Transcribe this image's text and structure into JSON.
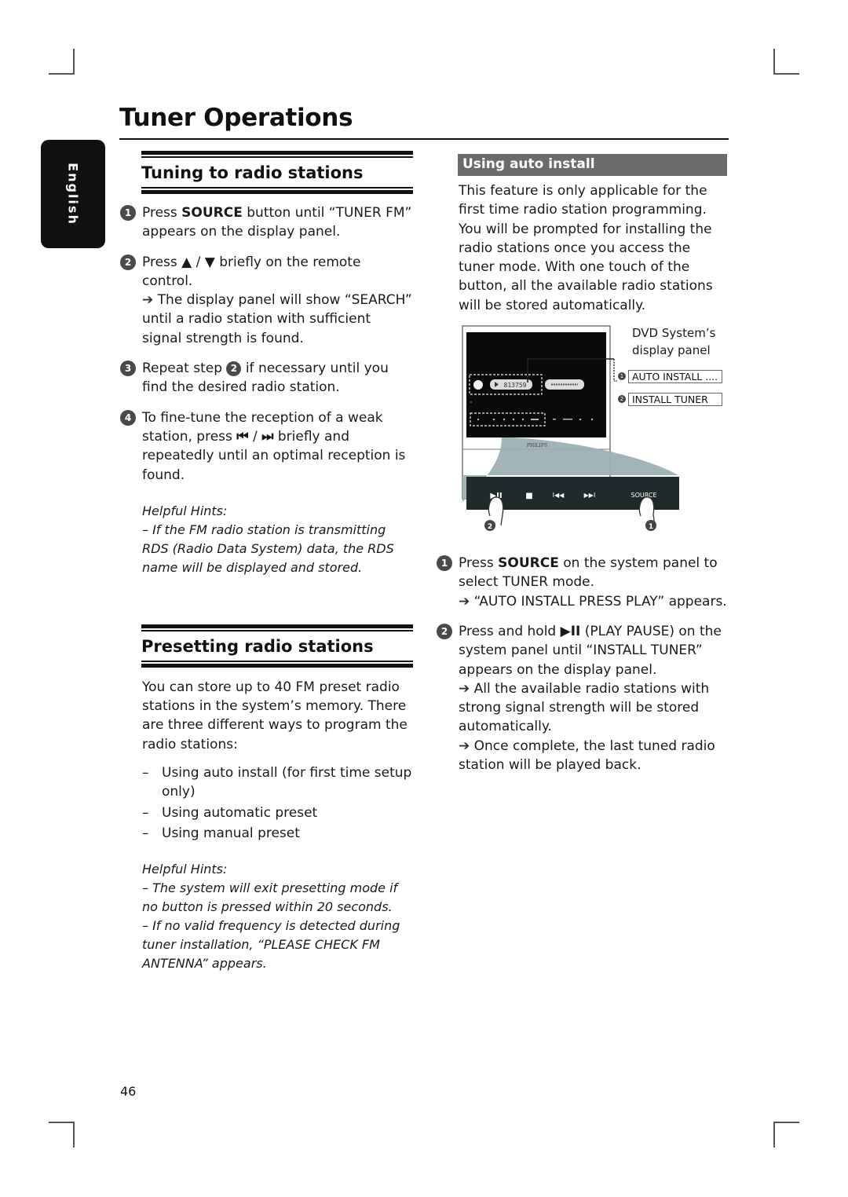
{
  "page": {
    "title": "Tuner Operations",
    "language_tab": "English",
    "page_number": "46"
  },
  "tuning": {
    "heading": "Tuning to radio stations",
    "steps": [
      {
        "num": "1",
        "pre": "Press ",
        "bold": "SOURCE",
        "post": " button until “TUNER FM” appears on the display panel."
      },
      {
        "num": "2",
        "text": "Press ▲ / ▼ briefly on the remote control.",
        "result": "The display panel will show “SEARCH” until a radio station with sufficient signal strength is found."
      },
      {
        "num": "3",
        "pre": "Repeat step ",
        "ref": "2",
        "post": " if necessary until you find the desired radio station."
      },
      {
        "num": "4",
        "pre": "To fine-tune the reception of a weak station, press ",
        "icon_prev": "⏮",
        "sep": " / ",
        "icon_next": "⏭",
        "post": " briefly and repeatedly until an optimal reception is found."
      }
    ],
    "hints_title": "Helpful Hints:",
    "hints": [
      "–  If the FM radio station is transmitting RDS (Radio Data System) data, the RDS name will be displayed and stored."
    ]
  },
  "presetting": {
    "heading": "Presetting radio stations",
    "intro": "You can store up to 40 FM preset radio stations in the system’s memory. There are three different ways to program the radio stations:",
    "bullets": [
      "Using auto install (for first time setup only)",
      "Using automatic preset",
      "Using manual preset"
    ],
    "hints_title": "Helpful Hints:",
    "hints": [
      "–  The system will exit presetting mode if no button is pressed within 20 seconds.",
      "–  If no valid frequency is detected during tuner installation, “PLEASE CHECK FM ANTENNA” appears."
    ]
  },
  "auto_install": {
    "heading": "Using auto install",
    "intro": "This feature is only applicable for the first time radio station programming. You will be prompted for installing the radio stations once you access the tuner mode. With one touch of the button, all the available radio stations will be stored automatically.",
    "figure": {
      "label": "DVD System’s display panel",
      "display_texts": [
        "AUTO INSTALL ....",
        "INSTALL TUNER"
      ],
      "display_nums": [
        "1",
        "2"
      ],
      "lcd_readout": "813759",
      "brand": "PHILIPS",
      "panel_buttons": [
        "▶II",
        "■",
        "I◀◀",
        "▶▶I",
        "SOURCE"
      ],
      "finger_labels": [
        "2",
        "1"
      ]
    },
    "steps": [
      {
        "num": "1",
        "pre": "Press ",
        "bold": "SOURCE",
        "post": " on the system panel to select TUNER mode.",
        "result": "“AUTO INSTALL PRESS PLAY” appears."
      },
      {
        "num": "2",
        "pre": "Press and hold ",
        "bold": "▶II",
        "post": " (PLAY PAUSE)  on the system panel until “INSTALL TUNER” appears on the display panel.",
        "results": [
          "All the available radio stations with strong signal strength will be stored automatically.",
          "Once complete, the last tuned radio station will be played back."
        ]
      }
    ]
  },
  "symbols": {
    "arrow": "➔",
    "dash": "–"
  }
}
